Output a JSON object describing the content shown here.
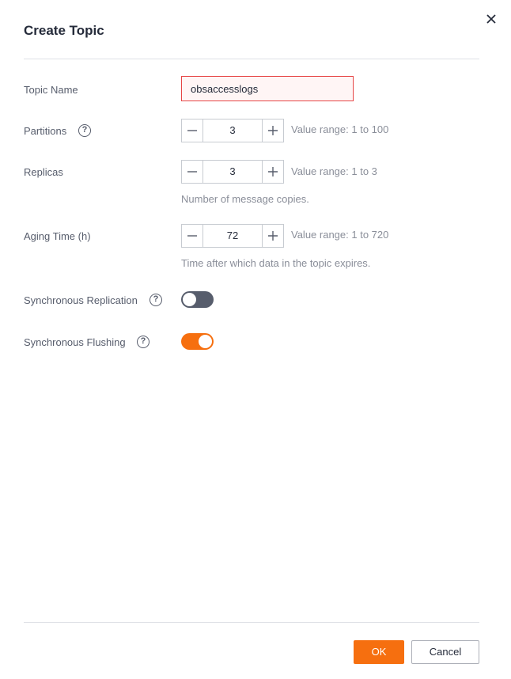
{
  "dialog": {
    "title": "Create Topic"
  },
  "fields": {
    "topic_name": {
      "label": "Topic Name",
      "value": "obsaccesslogs"
    },
    "partitions": {
      "label": "Partitions",
      "value": "3",
      "range": "Value range: 1 to 100"
    },
    "replicas": {
      "label": "Replicas",
      "value": "3",
      "range": "Value range: 1 to 3",
      "hint": "Number of message copies."
    },
    "aging_time": {
      "label": "Aging Time (h)",
      "value": "72",
      "range": "Value range: 1 to 720",
      "hint": "Time after which data in the topic expires."
    },
    "sync_replication": {
      "label": "Synchronous Replication",
      "enabled": false
    },
    "sync_flushing": {
      "label": "Synchronous Flushing",
      "enabled": true
    }
  },
  "icons": {
    "help": "?",
    "close": "close-icon",
    "minus": "minus-icon",
    "plus": "plus-icon"
  },
  "footer": {
    "ok_label": "OK",
    "cancel_label": "Cancel"
  },
  "colors": {
    "accent": "#f66f0f",
    "error_border": "#e64545",
    "error_bg": "#fff5f5",
    "toggle_off": "#575d6c"
  }
}
